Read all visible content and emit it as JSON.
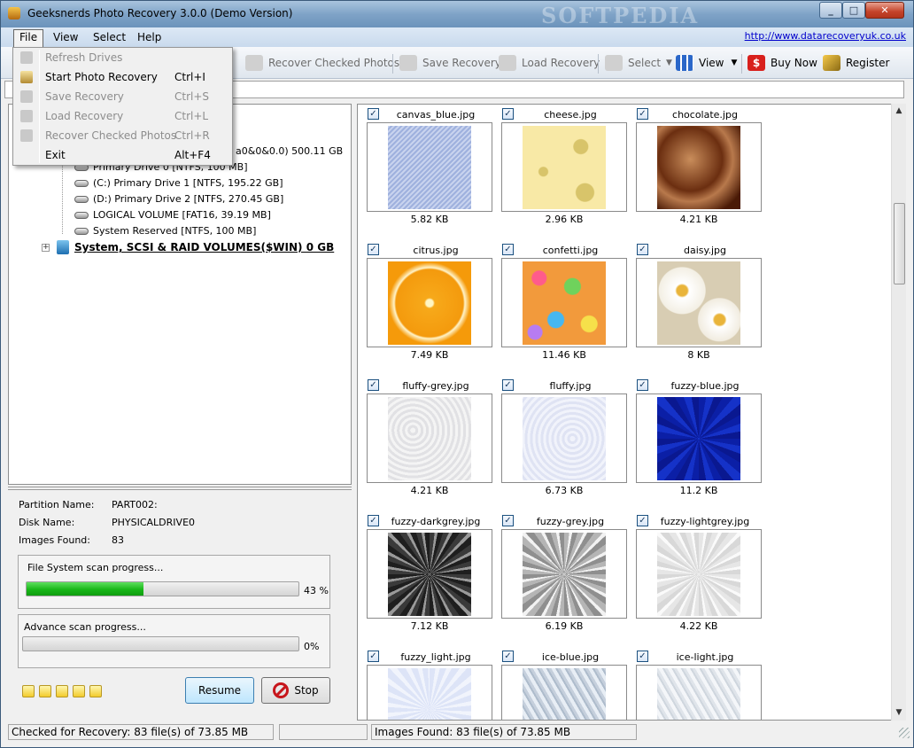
{
  "window": {
    "title": "Geeksnerds Photo Recovery 3.0.0 (Demo Version)",
    "watermark": "SOFTPEDIA",
    "minimize": "_",
    "maximize": "□",
    "close": "✕"
  },
  "menubar": {
    "items": [
      "File",
      "View",
      "Select",
      "Help"
    ],
    "url": "http://www.datarecoveryuk.co.uk"
  },
  "toolbar": {
    "recover_checked": "Recover Checked Photos",
    "save_recovery": "Save Recovery",
    "load_recovery": "Load Recovery",
    "select": "Select",
    "view": "View",
    "buy_now": "Buy Now",
    "register": "Register"
  },
  "file_menu": {
    "items": [
      {
        "label": "Refresh Drives",
        "shortcut": "",
        "enabled": false
      },
      {
        "label": "Start Photo Recovery",
        "shortcut": "Ctrl+I",
        "enabled": true
      },
      {
        "label": "Save Recovery",
        "shortcut": "Ctrl+S",
        "enabled": false
      },
      {
        "label": "Load Recovery",
        "shortcut": "Ctrl+L",
        "enabled": false
      },
      {
        "label": "Recover Checked Photos",
        "shortcut": "Ctrl+R",
        "enabled": false
      },
      {
        "label": "Exit",
        "shortcut": "Alt+F4",
        "enabled": true
      }
    ]
  },
  "tree": {
    "partial_top": "a0&0&0.0) 500.11 GB",
    "partial_primary0": "Primary Drive 0 [NTFS, 100 MB]",
    "drives": [
      "(C:) Primary Drive 1 [NTFS, 195.22 GB]",
      "(D:) Primary Drive 2 [NTFS, 270.45 GB]",
      "LOGICAL VOLUME [FAT16, 39.19 MB]",
      "System Reserved [NTFS, 100 MB]"
    ],
    "raid": "System, SCSI & RAID VOLUMES($WIN) 0 GB",
    "expander": "+"
  },
  "info": {
    "partition_label": "Partition Name:",
    "partition_value": "PART002:",
    "disk_label": "Disk Name:",
    "disk_value": "PHYSICALDRIVE0",
    "images_label": "Images Found:",
    "images_value": "83"
  },
  "progress": {
    "fs_caption": "File System scan progress...",
    "fs_percent": 43,
    "fs_text": "43 %",
    "adv_caption": "Advance scan progress...",
    "adv_percent": 0,
    "adv_text": "0%"
  },
  "buttons": {
    "resume": "Resume",
    "stop": "Stop"
  },
  "photos": [
    {
      "name": "canvas_blue.jpg",
      "size": "5.82 KB",
      "bg": "repeating-linear-gradient(135deg,#c8d3ee 0 2px,#9fb1de 2px 4px)"
    },
    {
      "name": "cheese.jpg",
      "size": "2.96 KB",
      "bg": "radial-gradient(circle at 70% 25%,#d8c46a 8px,transparent 9px),radial-gradient(circle at 75% 80%,#d8c46a 10px,transparent 11px),radial-gradient(circle at 25% 55%,#d8c46a 5px,transparent 6px),#f8e9a6"
    },
    {
      "name": "chocolate.jpg",
      "size": "4.21 KB",
      "bg": "radial-gradient(ellipse at 40% 40%,#c98d5b,#6b2e10 45%,#b8794c 60%,#4a1a06 85%)"
    },
    {
      "name": "citrus.jpg",
      "size": "7.49 KB",
      "bg": "radial-gradient(circle at 50% 50%,#fff6c4 4px,#f7a91a 6px,#f49a0d 38px,#fff3c8 40px,#f59a0a 46px)"
    },
    {
      "name": "confetti.jpg",
      "size": "11.46 KB",
      "bg": "radial-gradient(circle at 20% 20%,#ff5b8c 8px,transparent 9px),radial-gradient(circle at 60% 30%,#6fd25c 9px,transparent 10px),radial-gradient(circle at 40% 70%,#47b7f0 9px,transparent 10px),radial-gradient(circle at 80% 75%,#f6e04a 9px,transparent 10px),radial-gradient(circle at 15% 85%,#b77cf2 8px,transparent 9px),#f29a3c"
    },
    {
      "name": "daisy.jpg",
      "size": "8 KB",
      "bg": "radial-gradient(circle at 30% 35%,#e9b43a 6px,#fff 8px,#f3efe4 26px,transparent 27px),radial-gradient(circle at 75% 70%,#e9b43a 6px,#fff 8px,#f1ece0 24px,transparent 25px),#d8cdb3"
    },
    {
      "name": "fluffy-grey.jpg",
      "size": "4.21 KB",
      "bg": "repeating-radial-gradient(circle at 30% 40%,#f4f4f4 0 3px,#e1e1e4 3px 6px)"
    },
    {
      "name": "fluffy.jpg",
      "size": "6.73 KB",
      "bg": "repeating-radial-gradient(circle at 60% 50%,#f1f3fb 0 3px,#dfe3f3 3px 6px)"
    },
    {
      "name": "fuzzy-blue.jpg",
      "size": "11.2 KB",
      "bg": "repeating-conic-gradient(#0b1fa6 0 10deg,#1532c8 10deg 20deg,#0a1890 20deg 30deg)"
    },
    {
      "name": "fuzzy-darkgrey.jpg",
      "size": "7.12 KB",
      "bg": "repeating-conic-gradient(#3a3a3a 0 7deg,#9a9a9a 7deg 11deg,#1e1e1e 11deg 18deg)"
    },
    {
      "name": "fuzzy-grey.jpg",
      "size": "6.19 KB",
      "bg": "repeating-conic-gradient(#b5b5b5 0 7deg,#f2f2f2 7deg 11deg,#8f8f8f 11deg 18deg)"
    },
    {
      "name": "fuzzy-lightgrey.jpg",
      "size": "4.22 KB",
      "bg": "repeating-conic-gradient(#e6e6e6 0 7deg,#fafafa 7deg 11deg,#d8d8d8 11deg 18deg)"
    },
    {
      "name": "fuzzy_light.jpg",
      "size": "",
      "bg": "repeating-conic-gradient(#dde4f7 0 8deg,#f1f4fc 8deg 14deg)"
    },
    {
      "name": "ice-blue.jpg",
      "size": "",
      "bg": "repeating-linear-gradient(60deg,#c5cfdc 0 3px,#e8eef5 3px 7px,#aebccc 7px 9px)"
    },
    {
      "name": "ice-light.jpg",
      "size": "",
      "bg": "repeating-linear-gradient(60deg,#dfe4ea 0 3px,#f4f6f9 3px 7px,#cfd6de 7px 9px)"
    }
  ],
  "status": {
    "checked": "Checked for Recovery: 83 file(s) of 73.85 MB",
    "found": "Images Found: 83 file(s) of 73.85 MB"
  }
}
